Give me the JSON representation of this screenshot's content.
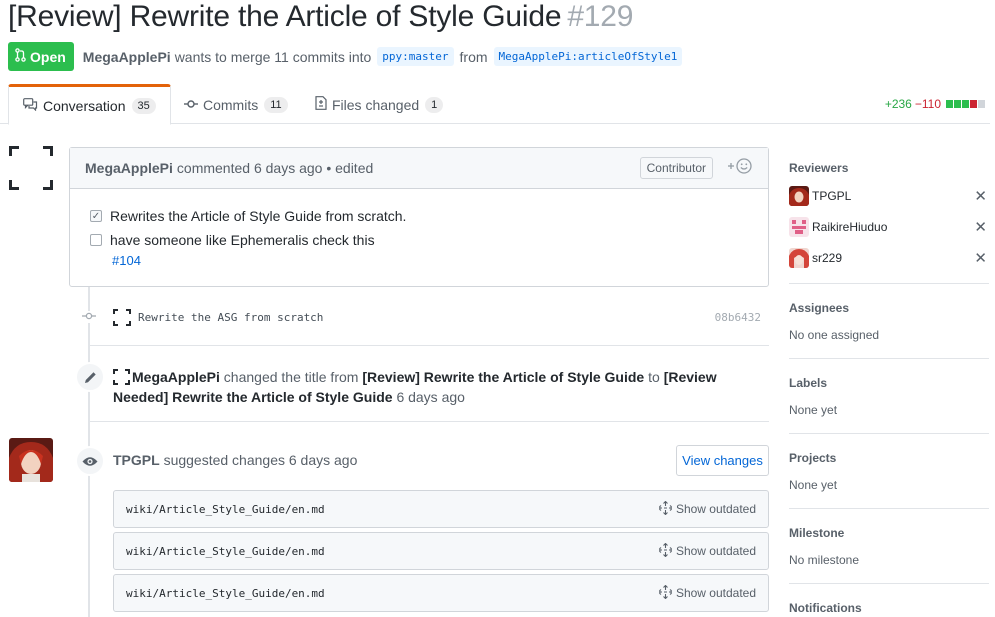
{
  "pr": {
    "title": "[Review] Rewrite the Article of Style Guide",
    "number": "#129",
    "state": "Open",
    "author": "MegaApplePi",
    "merge_text": "wants to merge 11 commits into",
    "base_branch": "ppy:master",
    "from_text": "from",
    "head_branch": "MegaApplePi:articleOfStyle1"
  },
  "tabs": [
    {
      "label": "Conversation",
      "count": "35",
      "icon": "comment-discussion-icon",
      "selected": true
    },
    {
      "label": "Commits",
      "count": "11",
      "icon": "git-commit-icon",
      "selected": false
    },
    {
      "label": "Files changed",
      "count": "1",
      "icon": "file-diff-icon",
      "selected": false
    }
  ],
  "diffstat": {
    "additions": "+236",
    "deletions": "−110",
    "blocks": [
      "#2cbe4e",
      "#2cbe4e",
      "#2cbe4e",
      "#cb2431",
      "#d1d5da"
    ]
  },
  "comment": {
    "author": "MegaApplePi",
    "meta": "commented 6 days ago • edited",
    "role": "Contributor",
    "reaction_icon": "smiley-icon",
    "tasks": [
      {
        "text": "Rewrites the Article of Style Guide from scratch.",
        "checked": true
      },
      {
        "text": "have someone like Ephemeralis check this",
        "checked": false
      }
    ],
    "issue_ref": "#104"
  },
  "commit": {
    "message": "Rewrite the ASG from scratch",
    "sha": "08b6432"
  },
  "title_event": {
    "actor": "MegaApplePi",
    "changed_text": "changed the title from",
    "old_title": "[Review] Rewrite the Article of Style Guide",
    "to_text": "to",
    "new_title": "[Review Needed] Rewrite the Article of Style Guide",
    "time": "6 days ago"
  },
  "review": {
    "author": "TPGPL",
    "action": "suggested changes 6 days ago",
    "view_button": "View changes",
    "files": [
      {
        "path": "wiki/Article_Style_Guide/en.md",
        "outdated_label": "Show outdated"
      },
      {
        "path": "wiki/Article_Style_Guide/en.md",
        "outdated_label": "Show outdated"
      },
      {
        "path": "wiki/Article_Style_Guide/en.md",
        "outdated_label": "Show outdated"
      }
    ]
  },
  "sidebar": {
    "reviewers_heading": "Reviewers",
    "reviewers": [
      {
        "name": "TPGPL"
      },
      {
        "name": "RaikireHiuduo"
      },
      {
        "name": "sr229"
      }
    ],
    "assignees_heading": "Assignees",
    "assignees_empty": "No one assigned",
    "labels_heading": "Labels",
    "labels_empty": "None yet",
    "projects_heading": "Projects",
    "projects_empty": "None yet",
    "milestone_heading": "Milestone",
    "milestone_empty": "No milestone",
    "notifications_heading": "Notifications"
  }
}
